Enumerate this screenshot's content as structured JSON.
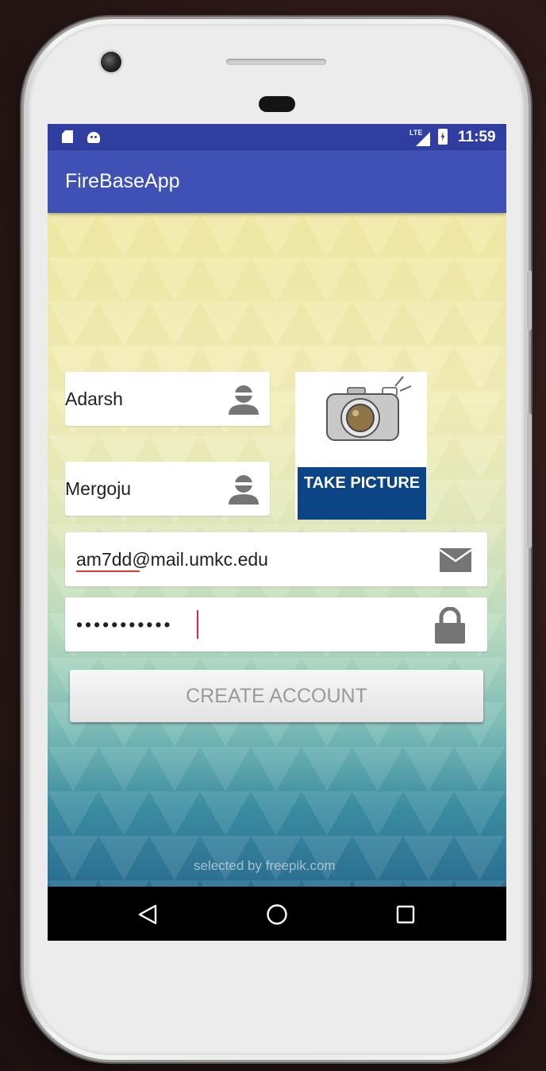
{
  "status_bar": {
    "time": "11:59",
    "network_label": "LTE",
    "icons": [
      "sd-card-icon",
      "android-debug-icon",
      "lte-signal-icon",
      "battery-charging-icon"
    ]
  },
  "app_bar": {
    "title": "FireBaseApp"
  },
  "form": {
    "first_name": {
      "value": "Adarsh",
      "icon": "person-icon"
    },
    "last_name": {
      "value": "Mergoju",
      "icon": "person-icon"
    },
    "email": {
      "value": "am7dd@mail.umkc.edu",
      "icon": "envelope-icon"
    },
    "password": {
      "value": "•••••••••••",
      "icon": "lock-icon"
    },
    "take_picture_label": "TAKE PICTURE",
    "create_button_label": "CREATE ACCOUNT"
  },
  "background_credit": "selected by freepik.com",
  "nav_bar": {
    "buttons": [
      "back-triangle-icon",
      "home-circle-icon",
      "recents-square-icon"
    ]
  },
  "colors": {
    "status_bar": "#303f9f",
    "app_bar": "#3f51b5",
    "take_picture_banner": "#0b4585",
    "cursor": "#e91e63",
    "spell_underline": "#e53935"
  }
}
